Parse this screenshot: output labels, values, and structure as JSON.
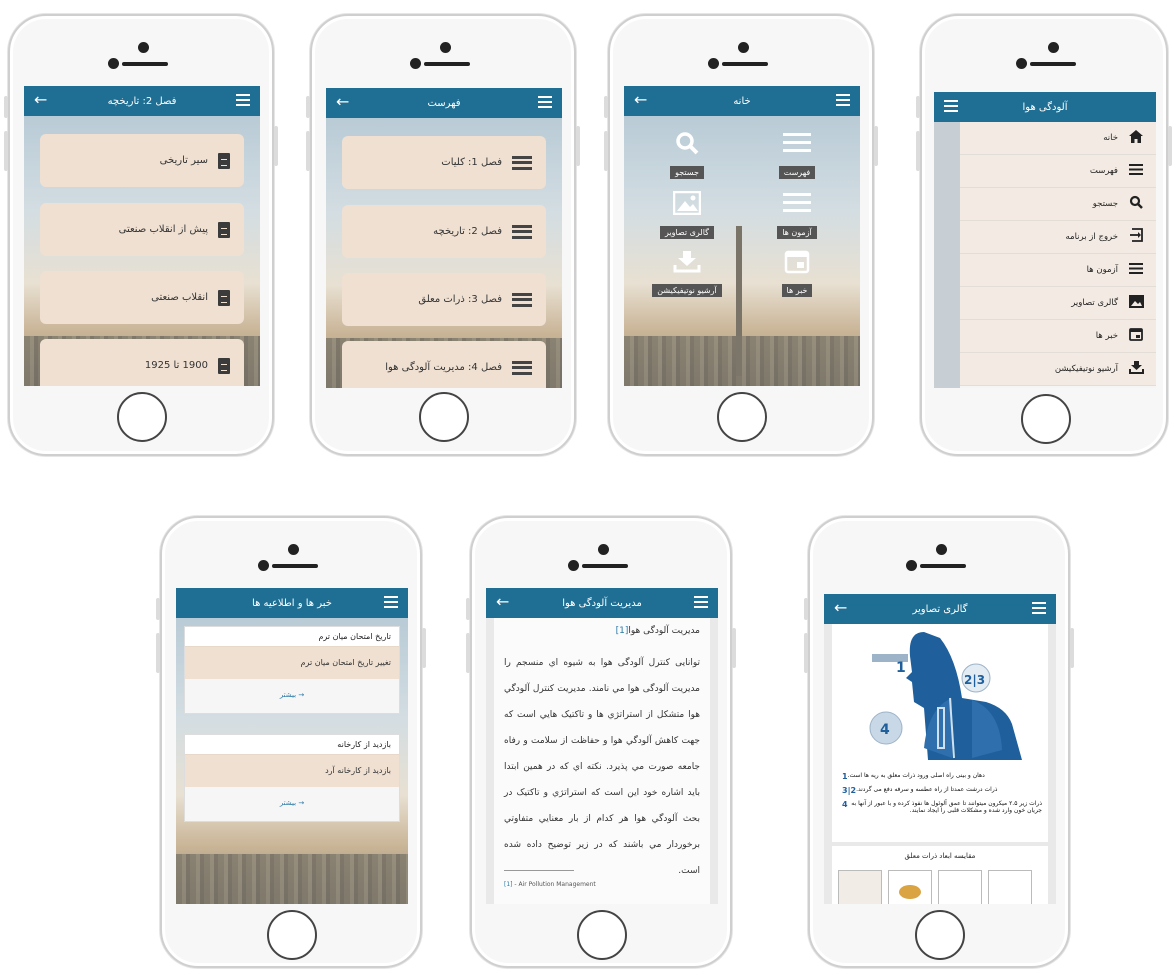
{
  "colors": {
    "appbar": "#1f6e93",
    "card": "#efe0d2",
    "tile_label_bg": "#555555",
    "link": "#2a7aa6"
  },
  "screens": {
    "ch2": {
      "title": "فصل 2: تاریخچه",
      "items": [
        {
          "label": "سیر تاریخی",
          "icon": "document-icon"
        },
        {
          "label": "پیش از انقلاب صنعتی",
          "icon": "document-icon"
        },
        {
          "label": "انقلاب صنعتی",
          "icon": "document-icon"
        },
        {
          "label": "1900 تا 1925",
          "icon": "document-icon"
        }
      ]
    },
    "toc": {
      "title": "فهرست",
      "items": [
        {
          "label": "فصل 1: کلیات",
          "icon": "list-icon"
        },
        {
          "label": "فصل 2: تاریخچه",
          "icon": "list-icon"
        },
        {
          "label": "فصل 3: ذرات معلق",
          "icon": "list-icon"
        },
        {
          "label": "فصل 4: مدیریت آلودگی هوا",
          "icon": "list-icon"
        }
      ]
    },
    "home": {
      "title": "خانه",
      "tiles": [
        {
          "label": "جستجو",
          "icon": "search-icon"
        },
        {
          "label": "فهرست",
          "icon": "list-icon"
        },
        {
          "label": "گالری تصاویر",
          "icon": "image-icon"
        },
        {
          "label": "آزمون ها",
          "icon": "list-icon"
        },
        {
          "label": "آرشیو نوتیفیکیشن",
          "icon": "download-icon"
        },
        {
          "label": "خبر ها",
          "icon": "calendar-icon"
        }
      ]
    },
    "drawer": {
      "title": "آلودگی هوا",
      "items": [
        {
          "label": "خانه",
          "icon": "home-icon"
        },
        {
          "label": "فهرست",
          "icon": "list-icon"
        },
        {
          "label": "جستجو",
          "icon": "search-icon"
        },
        {
          "label": "خروج از برنامه",
          "icon": "exit-icon"
        },
        {
          "label": "آزمون ها",
          "icon": "list-icon"
        },
        {
          "label": "گالری تصاویر",
          "icon": "image-icon"
        },
        {
          "label": "خبر ها",
          "icon": "calendar-icon"
        },
        {
          "label": "آرشیو نوتیفیکیشن",
          "icon": "download-icon"
        }
      ]
    },
    "news": {
      "title": "خبر ها و اطلاعیه ها",
      "more": "بیشتر",
      "items": [
        {
          "heading": "تاریخ امتحان میان ترم",
          "body": "تغییر تاریخ امتحان میان ترم"
        },
        {
          "heading": "بازدید از کارخانه",
          "body": "بازدید از کارخانه آرد"
        }
      ]
    },
    "article": {
      "title": "مدیریت آلودگی هوا",
      "heading": "مدیریت آلودگی هوا",
      "ref": "[1]",
      "body": "توانایی کنترل آلودگی هوا به شیوه اي منسجم را مدیریت آلودگی هوا مي نامند. مدیریت کنترل آلودگي هوا متشکل از استراتژي ها و تاکتیک هایي است که جهت کاهش آلودگي هوا و حفاظت از سلامت و رفاه جامعه صورت مي پذیرد. نکته اي که در همین ابتدا باید اشاره خود این است که استراتژي و تاکتیک در بحث آلودگي هوا هر کدام از بار معنایي متفاوتي برخوردار مي باشند که در زیر توضیح داده شده است.",
      "footnote_ref": "[1]",
      "footnote": " - Air Pollution Management"
    },
    "gallery": {
      "title": "گالری تصاویر",
      "figure_labels": [
        "1",
        "2|3",
        "4"
      ],
      "legend": [
        {
          "n": "1",
          "text": "دهان و بینی راه اصلی ورود ذرات معلق به ریه ها است."
        },
        {
          "n": "2|3",
          "text": "ذرات درشت عمدتا از راه عطسه و سرفه دفع می گردند."
        },
        {
          "n": "4",
          "text": "ذرات زیر ۲.۵ میکرون میتوانند تا عمق آلوئول ها نفوذ کرده و با عبور از آنها به جریان خون وارد شده و مشکلات قلبی را ایجاد نمایند."
        }
      ],
      "second_title": "مقایسه ابعاد ذرات معلق"
    }
  }
}
